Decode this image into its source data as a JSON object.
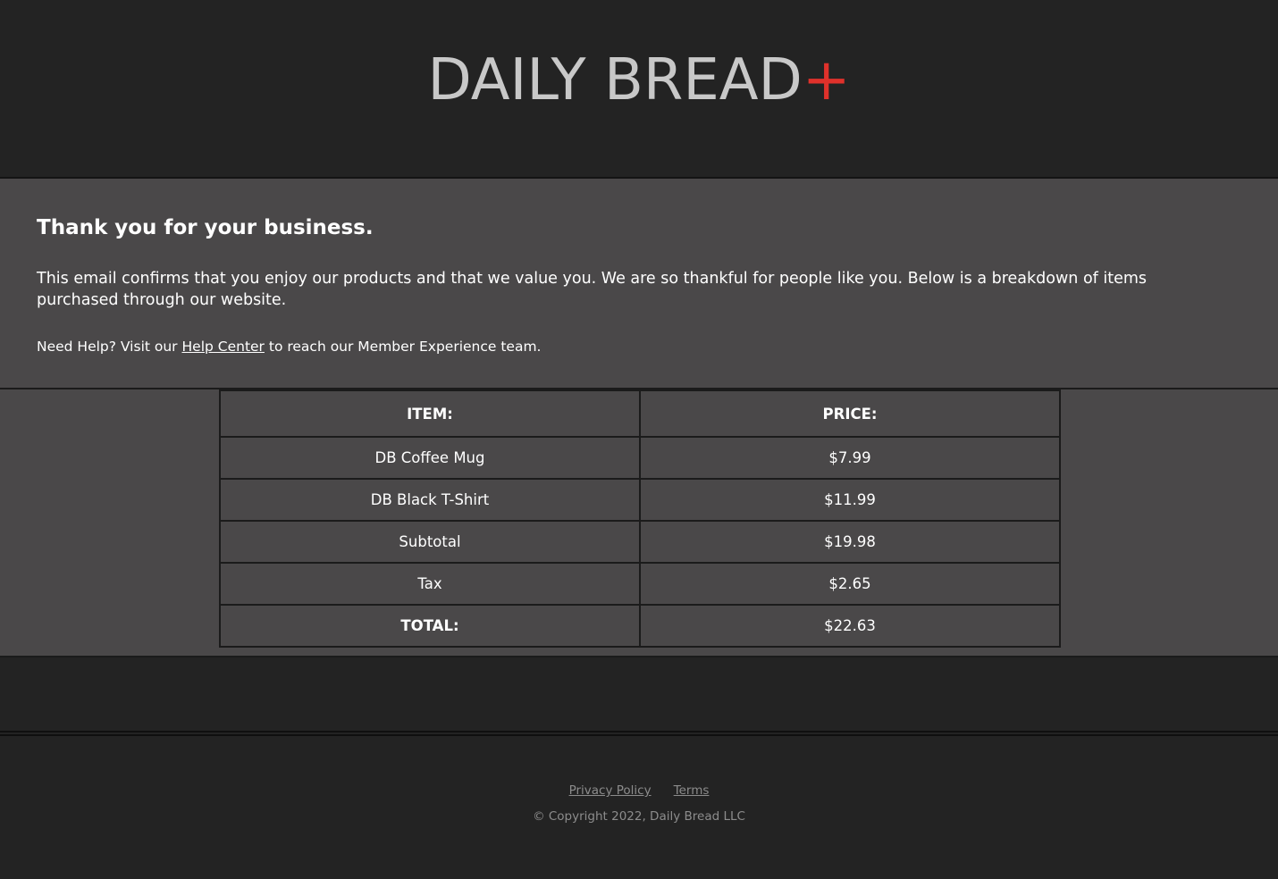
{
  "header": {
    "logo_text": "DAILY BREAD",
    "logo_plus": "+",
    "accent_color": "#e0312b"
  },
  "intro": {
    "heading": "Thank you for your business.",
    "message": "This email confirms that you enjoy our products and that we value you. We are so thankful for people like you. Below is a breakdown of items purchased through our website.",
    "help_prefix": "Need Help? Visit our ",
    "help_link": "Help Center",
    "help_suffix": " to reach our Member Experience team."
  },
  "table": {
    "headers": [
      "ITEM:",
      "PRICE:"
    ],
    "rows": [
      {
        "item": "DB Coffee Mug",
        "price": "$7.99"
      },
      {
        "item": "DB Black T-Shirt",
        "price": "$11.99"
      },
      {
        "item": "Subtotal",
        "price": "$19.98"
      },
      {
        "item": "Tax",
        "price": "$2.65"
      },
      {
        "item": "TOTAL:",
        "price": "$22.63"
      }
    ]
  },
  "footer": {
    "privacy": "Privacy Policy",
    "terms": "Terms",
    "copyright": "© Copyright 2022, Daily Bread LLC"
  }
}
